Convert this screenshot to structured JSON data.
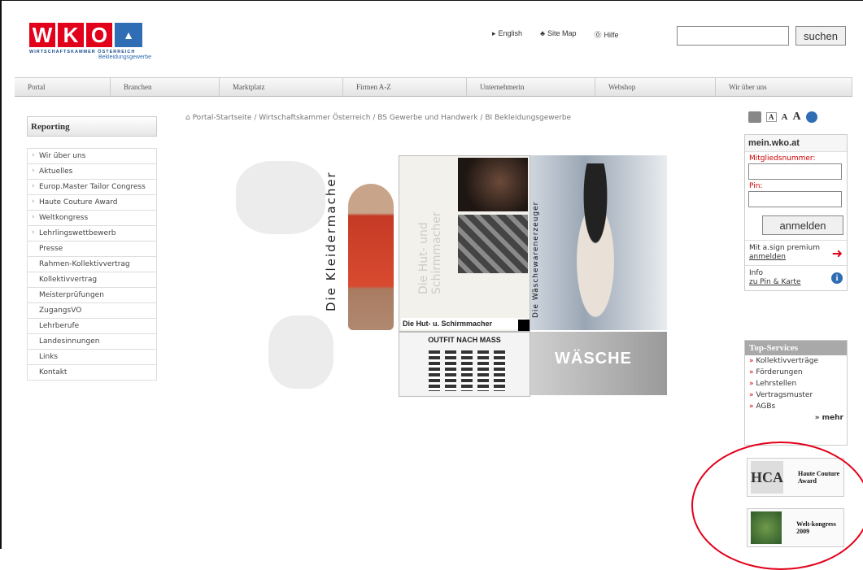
{
  "header": {
    "logo_letters": [
      "W",
      "K",
      "O"
    ],
    "logo_subtitle": "WIRTSCHAFTSKAMMER ÖSTERREICH",
    "logo_section": "Bekleidungsgewerbe",
    "links": [
      {
        "label": "English",
        "icon": "arrow-right-icon"
      },
      {
        "label": "Site Map",
        "icon": "sitemap-icon"
      },
      {
        "label": "Hilfe",
        "icon": "help-icon"
      }
    ],
    "search_value": "",
    "search_button": "suchen"
  },
  "nav": [
    "Portal",
    "Branchen",
    "Marktplatz",
    "Firmen A-Z",
    "Unternehmerin",
    "Webshop",
    "Wir über uns"
  ],
  "breadcrumb": "Portal-Startseite / Wirtschaftskammer Österreich / BS Gewerbe und Handwerk / BI Bekleidungsgewerbe",
  "sidebar": {
    "title": "Reporting",
    "items": [
      {
        "label": "Wir über uns",
        "arrow": true
      },
      {
        "label": "Aktuelles",
        "arrow": true
      },
      {
        "label": "Europ.Master Tailor Congress",
        "arrow": true
      },
      {
        "label": "Haute Couture Award",
        "arrow": true
      },
      {
        "label": "Weltkongress",
        "arrow": true
      },
      {
        "label": "Lehrlingswettbewerb",
        "arrow": true
      },
      {
        "label": "Presse",
        "arrow": false
      },
      {
        "label": "Rahmen-Kollektivvertrag",
        "arrow": false
      },
      {
        "label": "Kollektivvertrag",
        "arrow": false
      },
      {
        "label": "Meisterprüfungen",
        "arrow": false
      },
      {
        "label": "ZugangsVO",
        "arrow": false
      },
      {
        "label": "Lehrberufe",
        "arrow": false
      },
      {
        "label": "Landesinnungen",
        "arrow": false
      },
      {
        "label": "Links",
        "arrow": false
      },
      {
        "label": "Kontakt",
        "arrow": false
      }
    ]
  },
  "collage": {
    "kleider": "Die Kleidermacher",
    "hut_vertical": "Die Hut- und Schirmmacher",
    "hut_caption": "Die Hut- u. Schirmmacher",
    "waesche_vertical": "Die Wäschewarenerzeuger",
    "outfit": "OUTFIT NACH MASS",
    "waesche": "WÄSCHE"
  },
  "login": {
    "title": "mein.wko.at",
    "member_label": "Mitgliedsnummer:",
    "pin_label": "Pin:",
    "button": "anmelden",
    "asign_text": "Mit a.sign premium",
    "asign_link": "anmelden",
    "info_text": "Info",
    "info_link": "zu Pin & Karte"
  },
  "top_services": {
    "title": "Top-Services",
    "items": [
      "Kollektivverträge",
      "Förderungen",
      "Lehrstellen",
      "Vertragsmuster",
      "AGBs"
    ],
    "more": "» mehr"
  },
  "ads": [
    {
      "logo": "HCA",
      "text": "Haute Couture Award"
    },
    {
      "logo": "",
      "text": "Welt-kongress 2009"
    }
  ],
  "colors": {
    "brand_red": "#e2001a",
    "brand_blue": "#2f6db5",
    "annotation_circle": "#e2001a"
  }
}
